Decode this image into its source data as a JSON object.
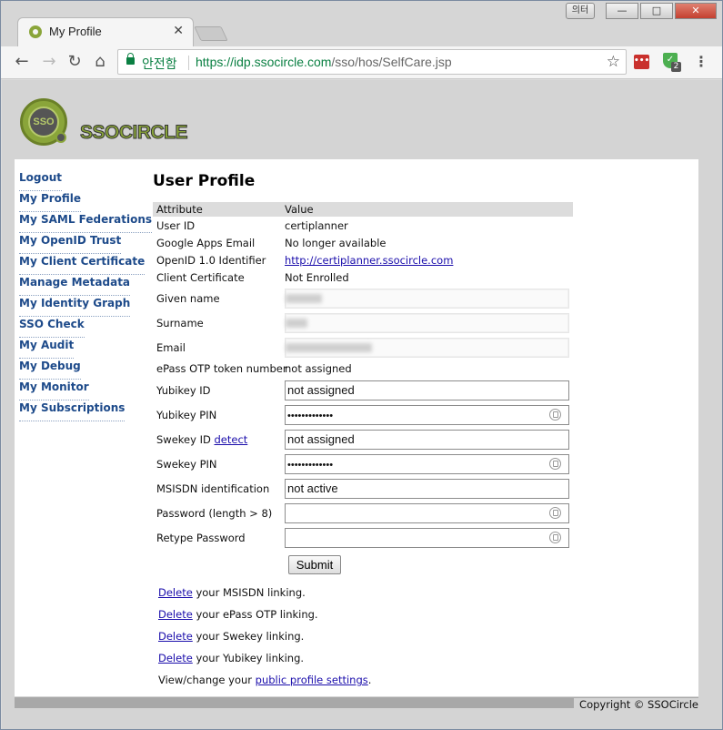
{
  "window": {
    "ime_label": "의터",
    "minimize": "—",
    "maximize": "□",
    "close": "✕"
  },
  "tab": {
    "title": "My Profile",
    "close": "✕"
  },
  "toolbar": {
    "back": "←",
    "forward": "→",
    "reload": "↻",
    "home": "⌂",
    "secure_label": "안전함",
    "url_host": "https://idp.ssocircle.com",
    "url_path": "/sso/hos/SelfCare.jsp",
    "star": "☆",
    "ext1": "•••",
    "ext2_badge": "2",
    "ext2_check": "✓",
    "menu": "⋮"
  },
  "logo": {
    "badge": "SSO",
    "text": "SSOCIRCLE"
  },
  "sidebar": {
    "items": [
      "Logout",
      "My Profile",
      "My SAML Federations",
      "My OpenID Trust",
      "My Client Certificate",
      "Manage Metadata",
      "My Identity Graph",
      "SSO Check",
      "My Audit",
      "My Debug",
      "My Monitor",
      "My Subscriptions"
    ]
  },
  "main": {
    "title": "User Profile",
    "header": {
      "attribute": "Attribute",
      "value": "Value"
    },
    "user_id": {
      "label": "User ID",
      "value": "certiplanner"
    },
    "google_email": {
      "label": "Google Apps Email",
      "value": "No longer available"
    },
    "openid": {
      "label": "OpenID 1.0 Identifier",
      "value": "http://certiplanner.ssocircle.com"
    },
    "client_cert": {
      "label": "Client Certificate",
      "value": "Not Enrolled"
    },
    "given_name": {
      "label": "Given name"
    },
    "surname": {
      "label": "Surname"
    },
    "email": {
      "label": "Email"
    },
    "epass": {
      "label": "ePass OTP token number",
      "value": "not assigned"
    },
    "yubikey_id": {
      "label": "Yubikey ID",
      "value": "not assigned"
    },
    "yubikey_pin": {
      "label": "Yubikey PIN",
      "value": "•••••••••••••"
    },
    "swekey_id": {
      "label": "Swekey ID",
      "detect": "detect",
      "value": "not assigned"
    },
    "swekey_pin": {
      "label": "Swekey PIN",
      "value": "•••••••••••••"
    },
    "msisdn": {
      "label": "MSISDN identification",
      "value": "not active"
    },
    "password": {
      "label": "Password (length > 8)",
      "value": ""
    },
    "retype": {
      "label": "Retype Password",
      "value": ""
    },
    "submit": "Submit"
  },
  "actions": {
    "delete_link": "Delete",
    "msisdn_text": " your MSISDN linking.",
    "epass_text": " your ePass OTP linking.",
    "swekey_text": " your Swekey linking.",
    "yubikey_text": " your Yubikey linking.",
    "public_prefix": "View/change your ",
    "public_link": "public profile settings",
    "public_suffix": "."
  },
  "footer": {
    "copyright": "Copyright © SSOCircle"
  }
}
